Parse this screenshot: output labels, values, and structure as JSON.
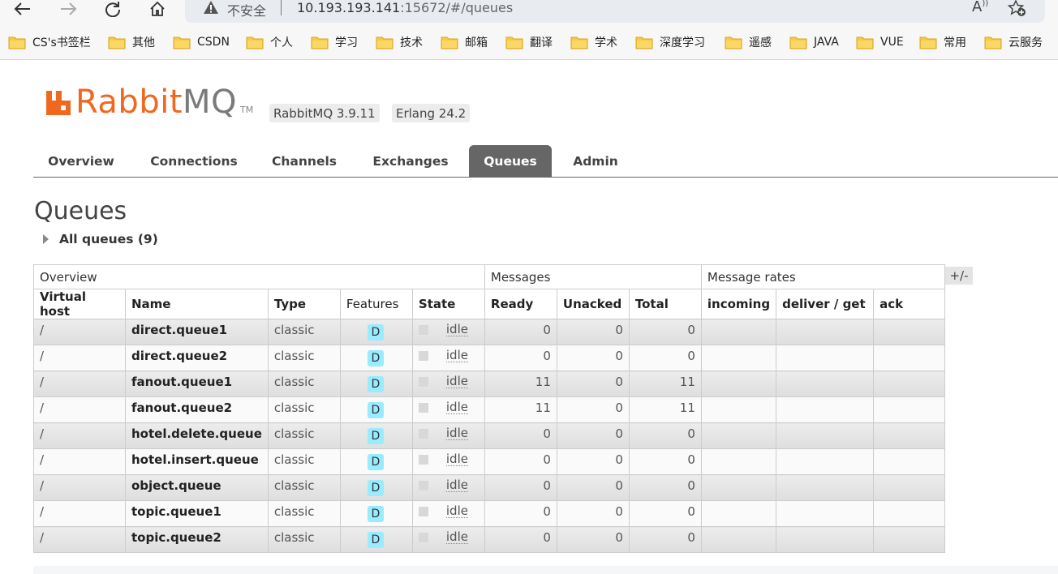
{
  "browser": {
    "security_label": "不安全",
    "url_host": "10.193.193.141",
    "url_rest": ":15672/#/queues",
    "read_aloud": "Á⁾"
  },
  "bookmarks": [
    "CS's书签栏",
    "其他",
    "CSDN",
    "个人",
    "学习",
    "技术",
    "邮箱",
    "翻译",
    "学术",
    "深度学习",
    "遥感",
    "JAVA",
    "VUE",
    "常用",
    "云服务"
  ],
  "header": {
    "logo_rabbit": "Rabbit",
    "logo_mq": "MQ",
    "logo_tm": "TM",
    "version": "RabbitMQ 3.9.11",
    "erlang": "Erlang 24.2"
  },
  "tabs": [
    "Overview",
    "Connections",
    "Channels",
    "Exchanges",
    "Queues",
    "Admin"
  ],
  "active_tab": "Queues",
  "page": {
    "title": "Queues",
    "all_queues": "All queues (9)",
    "plus_minus": "+/-"
  },
  "table": {
    "groups": [
      "Overview",
      "Messages",
      "Message rates"
    ],
    "columns": [
      "Virtual host",
      "Name",
      "Type",
      "Features",
      "State",
      "Ready",
      "Unacked",
      "Total",
      "incoming",
      "deliver / get",
      "ack"
    ],
    "rows": [
      {
        "vhost": "/",
        "name": "direct.queue1",
        "type": "classic",
        "feature": "D",
        "state": "idle",
        "ready": "0",
        "unacked": "0",
        "total": "0"
      },
      {
        "vhost": "/",
        "name": "direct.queue2",
        "type": "classic",
        "feature": "D",
        "state": "idle",
        "ready": "0",
        "unacked": "0",
        "total": "0"
      },
      {
        "vhost": "/",
        "name": "fanout.queue1",
        "type": "classic",
        "feature": "D",
        "state": "idle",
        "ready": "11",
        "unacked": "0",
        "total": "11"
      },
      {
        "vhost": "/",
        "name": "fanout.queue2",
        "type": "classic",
        "feature": "D",
        "state": "idle",
        "ready": "11",
        "unacked": "0",
        "total": "11"
      },
      {
        "vhost": "/",
        "name": "hotel.delete.queue",
        "type": "classic",
        "feature": "D",
        "state": "idle",
        "ready": "0",
        "unacked": "0",
        "total": "0"
      },
      {
        "vhost": "/",
        "name": "hotel.insert.queue",
        "type": "classic",
        "feature": "D",
        "state": "idle",
        "ready": "0",
        "unacked": "0",
        "total": "0"
      },
      {
        "vhost": "/",
        "name": "object.queue",
        "type": "classic",
        "feature": "D",
        "state": "idle",
        "ready": "0",
        "unacked": "0",
        "total": "0"
      },
      {
        "vhost": "/",
        "name": "topic.queue1",
        "type": "classic",
        "feature": "D",
        "state": "idle",
        "ready": "0",
        "unacked": "0",
        "total": "0"
      },
      {
        "vhost": "/",
        "name": "topic.queue2",
        "type": "classic",
        "feature": "D",
        "state": "idle",
        "ready": "0",
        "unacked": "0",
        "total": "0"
      }
    ]
  },
  "colors": {
    "brand_orange": "#f06820",
    "active_tab_bg": "#666666",
    "feature_badge": "#99ebff"
  }
}
